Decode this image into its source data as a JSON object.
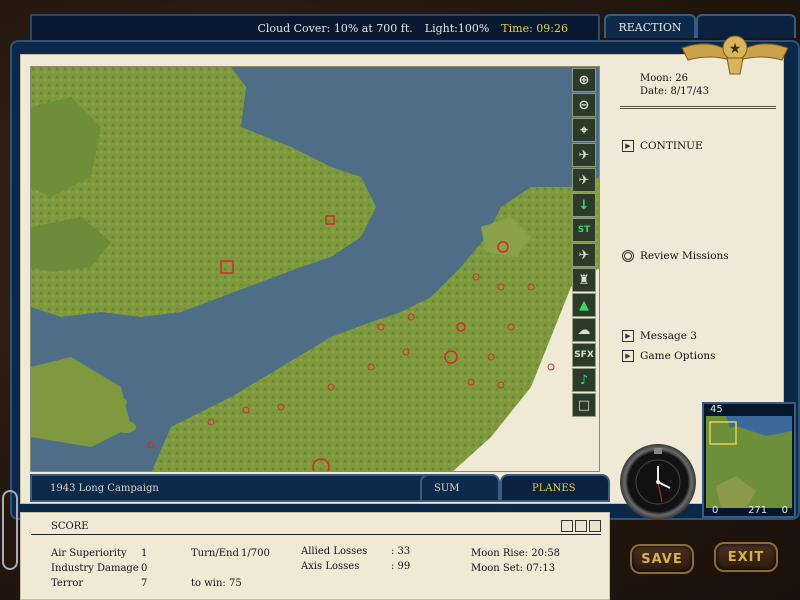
{
  "status_bar": {
    "cloud_cover": "Cloud Cover: 10% at 700 ft.",
    "light": "Light:100%",
    "time": "Time: 09:26"
  },
  "tabs": {
    "reaction": "REACTION",
    "summary": "SUM",
    "planes": "PLANES"
  },
  "campaign": {
    "name": "1943 Long Campaign"
  },
  "info": {
    "moon": "Moon:  26",
    "date": "Date:  8/17/43"
  },
  "menu": {
    "continue": "CONTINUE",
    "review_missions": "Review Missions",
    "message": "Message 3",
    "game_options": "Game Options"
  },
  "toolbar": {
    "items": [
      {
        "name": "zoom-in",
        "glyph": "⊕"
      },
      {
        "name": "zoom-out",
        "glyph": "⊖"
      },
      {
        "name": "target",
        "glyph": "⌖"
      },
      {
        "name": "fighter",
        "glyph": "✈"
      },
      {
        "name": "allied-plane",
        "glyph": "✈"
      },
      {
        "name": "pin",
        "glyph": "↓"
      },
      {
        "name": "st",
        "glyph": "ST"
      },
      {
        "name": "bomber",
        "glyph": "✈"
      },
      {
        "name": "flak",
        "glyph": "♜"
      },
      {
        "name": "ground",
        "glyph": "▲"
      },
      {
        "name": "weather",
        "glyph": "☁"
      },
      {
        "name": "sfx",
        "glyph": "SFX"
      },
      {
        "name": "music",
        "glyph": "♪"
      },
      {
        "name": "square",
        "glyph": "□"
      }
    ]
  },
  "score": {
    "title": "SCORE",
    "air_superiority_label": "Air Superiority",
    "air_superiority_value": "1",
    "industry_damage_label": "Industry Damage",
    "industry_damage_value": "0",
    "terror_label": "Terror",
    "terror_value": "7",
    "turn_end_label": "Turn/End",
    "turn_end_value": "1/700",
    "to_win_label": "to win:",
    "to_win_value": "75",
    "allied_losses_label": "Allied Losses",
    "allied_losses_value": ": 33",
    "axis_losses_label": "Axis Losses",
    "axis_losses_value": ": 99",
    "moon_rise": "Moon Rise: 20:58",
    "moon_set": "Moon Set: 07:13"
  },
  "minimap": {
    "top": "45",
    "bottom_left": "0",
    "bottom_mid": "271",
    "bottom_right": "0"
  },
  "buttons": {
    "save": "SAVE",
    "exit": "EXIT"
  },
  "colors": {
    "binder_blue": "#0c2848",
    "highlight_yellow": "#e5d44a",
    "target_red": "#d42a2a"
  }
}
